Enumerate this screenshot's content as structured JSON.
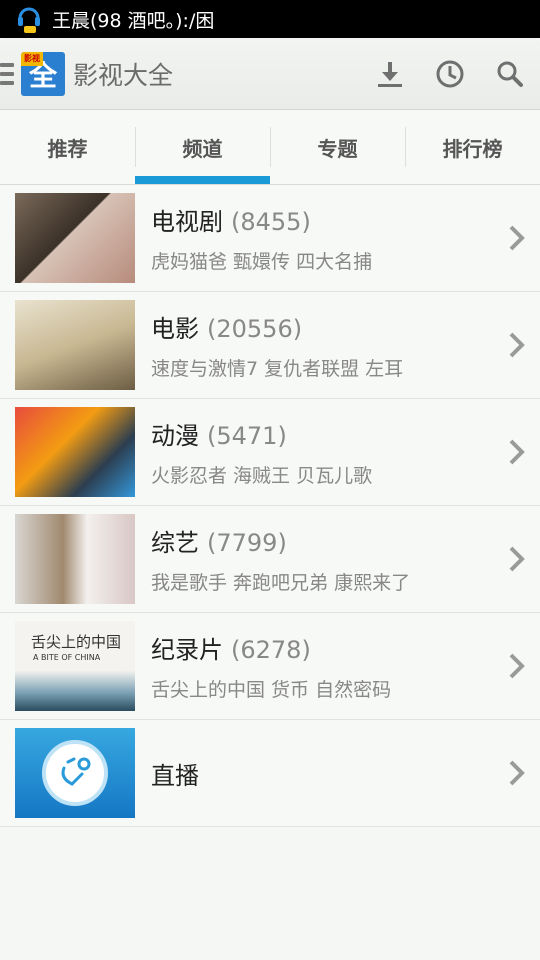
{
  "status_bar": {
    "notification": "王晨(98  酒吧。):/困"
  },
  "action_bar": {
    "logo_text": "全",
    "logo_badge": "影视",
    "title": "影视大全",
    "icons": [
      "download-icon",
      "history-icon",
      "search-icon"
    ]
  },
  "tabs": [
    {
      "label": "推荐",
      "active": false
    },
    {
      "label": "频道",
      "active": true
    },
    {
      "label": "专题",
      "active": false
    },
    {
      "label": "排行榜",
      "active": false
    }
  ],
  "channels": [
    {
      "title": "电视剧",
      "count": "(8455)",
      "subtitle": "虎妈猫爸 甄嬛传 四大名捕"
    },
    {
      "title": "电影",
      "count": "(20556)",
      "subtitle": "速度与激情7 复仇者联盟 左耳"
    },
    {
      "title": "动漫",
      "count": "(5471)",
      "subtitle": "火影忍者 海贼王 贝瓦儿歌"
    },
    {
      "title": "综艺",
      "count": "(7799)",
      "subtitle": "我是歌手 奔跑吧兄弟 康熙来了"
    },
    {
      "title": "纪录片",
      "count": "(6278)",
      "subtitle": "舌尖上的中国 货币 自然密码",
      "thumb_text": "舌尖上的中国",
      "thumb_sub": "A BITE OF CHINA"
    },
    {
      "title": "直播",
      "count": "",
      "subtitle": ""
    }
  ],
  "colors": {
    "accent": "#1a9ad6",
    "logo_blue": "#2b7fd0"
  }
}
